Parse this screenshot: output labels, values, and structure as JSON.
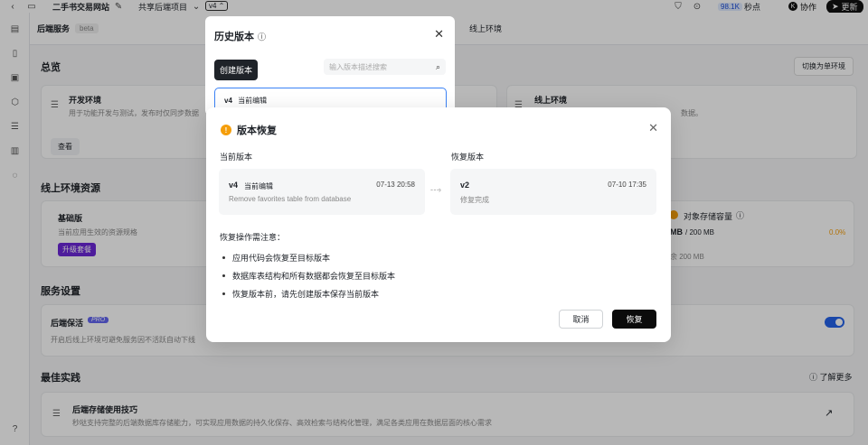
{
  "topbar": {
    "site_name": "二手书交易网站",
    "project": "共享后端项目",
    "version": "v4",
    "score": "98.1K",
    "score_unit": "秒点",
    "avatar_initial": "K",
    "collab": "协作",
    "update": "更新"
  },
  "subnav": {
    "title": "后端服务",
    "beta": "beta",
    "tab_online": "线上环境"
  },
  "overview": {
    "title": "总览",
    "switch_btn": "切换为单环境",
    "dev": {
      "title": "开发环境",
      "desc": "用于功能开发与测试，发布时仅同步数据",
      "view": "查看"
    },
    "online": {
      "title": "线上环境",
      "desc": "数据。"
    }
  },
  "resources": {
    "title": "线上环境资源",
    "basic": {
      "title": "基础版",
      "desc": "当前应用生效的资源规格",
      "upgrade": "升级套餐"
    },
    "storage": {
      "title": "对象存储容量",
      "value_suffix": "MB",
      "total": "/ 200 MB",
      "percent": "0.0%",
      "remain": "余 200 MB"
    }
  },
  "service": {
    "title": "服务设置",
    "keepalive": {
      "title": "后端保活",
      "pro": "PRO",
      "desc": "开启后线上环境可避免服务因不活跃自动下线"
    }
  },
  "best": {
    "title": "最佳实践",
    "learn": "了解更多",
    "tip": {
      "title": "后端存储使用技巧",
      "desc": "秒哒支持完整的后端数据库存储能力，可实现应用数据的持久化保存、高效检索与结构化管理，满足各类应用在数据层面的核心需求"
    }
  },
  "history": {
    "title": "历史版本",
    "create": "创建版本",
    "search_placeholder": "输入版本描述搜索",
    "row": {
      "version": "v4",
      "tag": "当前编辑"
    }
  },
  "dialog": {
    "title": "版本恢复",
    "current_label": "当前版本",
    "restore_label": "恢复版本",
    "current": {
      "version": "v4",
      "tag": "当前编辑",
      "date": "07-13 20:58",
      "desc": "Remove favorites table from database"
    },
    "target": {
      "version": "v2",
      "date": "07-10 17:35",
      "desc": "修复完成"
    },
    "notes_title": "恢复操作需注意：",
    "notes": [
      "应用代码会恢复至目标版本",
      "数据库表结构和所有数据都会恢复至目标版本",
      "恢复版本前，请先创建版本保存当前版本"
    ],
    "cancel": "取消",
    "confirm": "恢复"
  }
}
